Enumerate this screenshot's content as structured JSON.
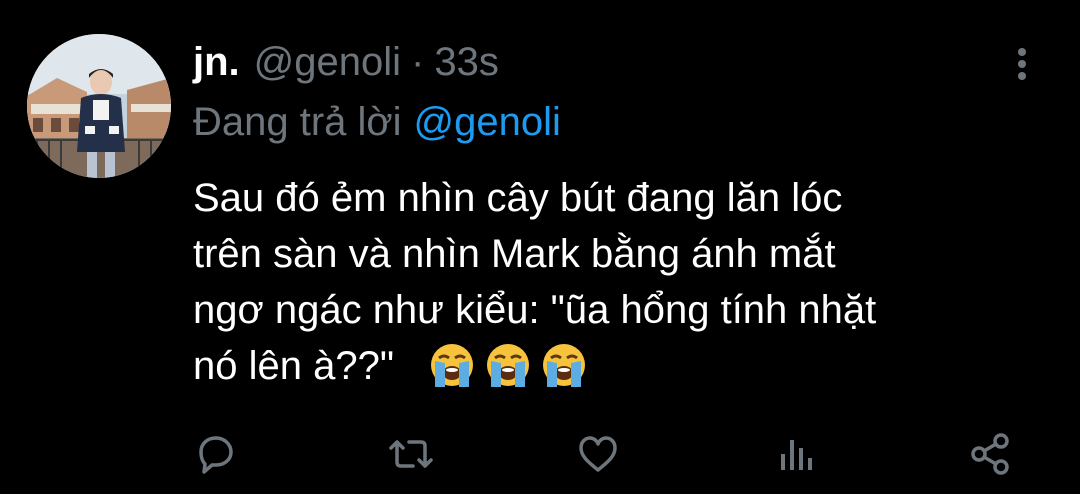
{
  "tweet": {
    "display_name": "jn.",
    "handle": "@genoli",
    "separator": "·",
    "time": "33s",
    "reply": {
      "prefix": "Đang trả lời",
      "mention": "@genoli"
    },
    "body_lines": [
      "Sau đó ẻm nhìn cây bút đang lăn lóc",
      "trên sàn và nhìn Mark bằng ánh mắt",
      "ngơ ngác như kiểu: \"ũa hổng tính nhặt",
      "nó lên à??\""
    ],
    "emojis": [
      "loudly-crying-face",
      "loudly-crying-face",
      "loudly-crying-face"
    ]
  },
  "icons": {
    "more": "more-vertical-icon",
    "reply": "reply-icon",
    "retweet": "retweet-icon",
    "like": "heart-icon",
    "analytics": "analytics-icon",
    "share": "share-icon"
  },
  "colors": {
    "background": "#000000",
    "text": "#ffffff",
    "secondary": "#6e767d",
    "mention": "#1d9bf0",
    "emoji_face": "#f7c33c"
  }
}
